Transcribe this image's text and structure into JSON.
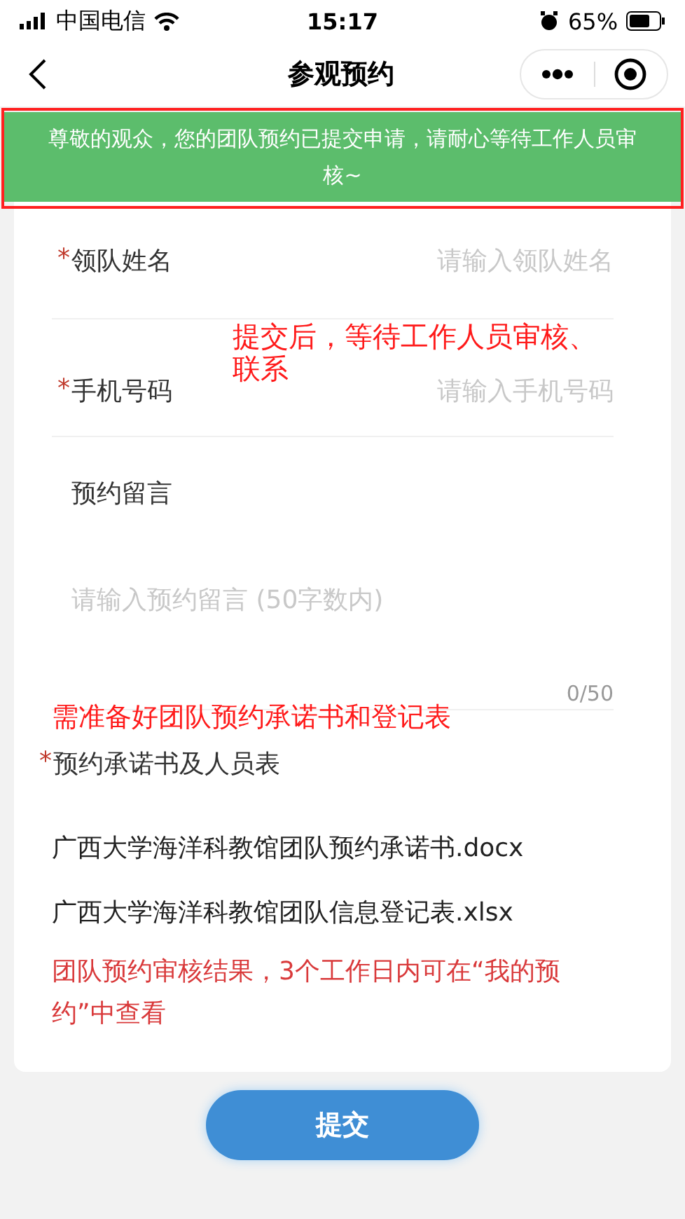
{
  "status_bar": {
    "carrier": "中国电信",
    "time": "15:17",
    "battery": "65%"
  },
  "nav": {
    "title": "参观预约"
  },
  "notice": {
    "text": "尊敬的观众，您的团队预约已提交申请，请耐心等待工作人员审核~",
    "highlighted": true
  },
  "form": {
    "required_mark": "*",
    "fields": [
      {
        "kind": "input",
        "label": "领队姓名",
        "required": true,
        "placeholder": "请输入领队姓名"
      },
      {
        "kind": "input",
        "label": "手机号码",
        "required": true,
        "placeholder": "请输入手机号码",
        "annotation": "提交后，等待工作人员审核、联系"
      },
      {
        "kind": "textarea",
        "label": "预约留言",
        "required": false,
        "placeholder": "请输入预约留言 (50字数内)",
        "counter": "0/50"
      },
      {
        "kind": "files",
        "label": "预约承诺书及人员表",
        "required": true,
        "annotation": "需准备好团队预约承诺书和登记表",
        "files": [
          "广西大学海洋科教馆团队预约承诺书.docx",
          "广西大学海洋科教馆团队信息登记表.xlsx"
        ]
      }
    ],
    "note": "团队预约审核结果，3个工作日内可在“我的预约”中查看"
  },
  "submit": {
    "label": "提交"
  }
}
